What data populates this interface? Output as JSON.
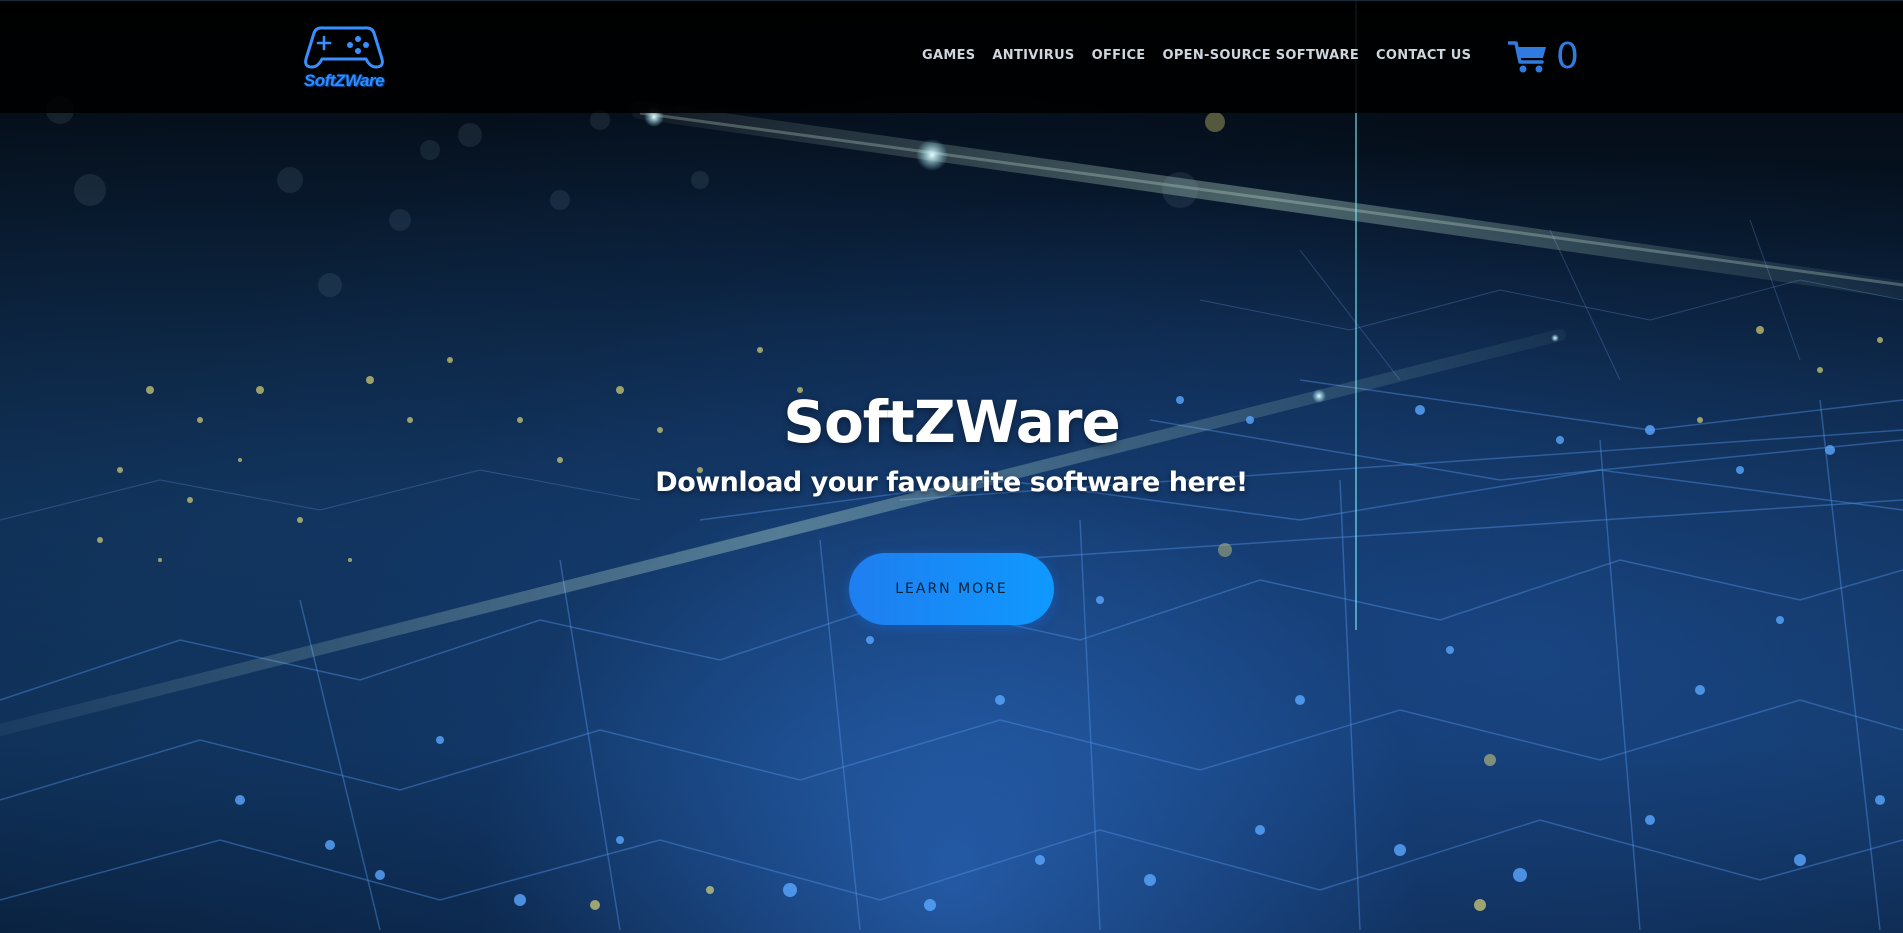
{
  "header": {
    "logo_text": "SoftZWare",
    "nav": [
      {
        "label": "GAMES"
      },
      {
        "label": "ANTIVIRUS"
      },
      {
        "label": "OFFICE"
      },
      {
        "label": "OPEN-SOURCE SOFTWARE"
      },
      {
        "label": "CONTACT US"
      }
    ],
    "cart_count": "0",
    "cart_icon": "shopping-cart-icon",
    "accent_color": "#2f7be0"
  },
  "hero": {
    "title": "SoftZWare",
    "subtitle": "Download your favourite software here!",
    "cta_label": "LEARN MORE",
    "cta_color": "#1b8cff"
  }
}
